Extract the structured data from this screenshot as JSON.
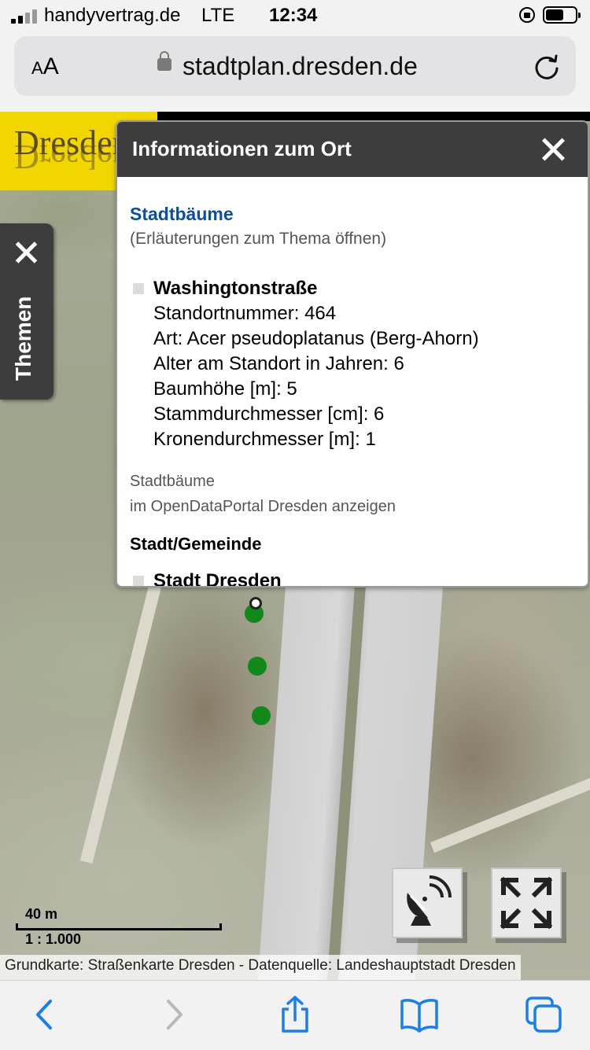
{
  "status_bar": {
    "carrier": "handyvertrag.de",
    "network": "LTE",
    "time": "12:34"
  },
  "browser": {
    "text_size_label_small": "A",
    "text_size_label_large": "A",
    "url": "stadtplan.dresden.de",
    "icons": {
      "lock": "padlock-icon",
      "reload": "reload-icon",
      "back": "chevron-left-icon",
      "forward": "chevron-right-icon",
      "share": "share-icon",
      "bookmarks": "book-icon",
      "tabs": "tabs-icon"
    }
  },
  "map": {
    "logo_text": "Dresden",
    "themen_label": "Themen",
    "scale": {
      "distance": "40 m",
      "ratio": "1 : 1.000"
    },
    "attribution": "Grundkarte: Straßenkarte Dresden - Datenquelle: Landeshauptstadt Dresden",
    "buttons": {
      "locate": "satellite-dish-icon",
      "fullscreen": "expand-arrows-icon"
    }
  },
  "popup": {
    "title": "Informationen zum Ort",
    "theme_link": "Stadtbäume",
    "theme_sub": "(Erläuterungen zum Thema öffnen)",
    "feature": {
      "name": "Washingtonstraße",
      "attributes": [
        "Standortnummer: 464",
        "Art: Acer pseudoplatanus (Berg-Ahorn)",
        "Alter am Standort in Jahren: 6",
        "Baumhöhe [m]: 5",
        "Stammdurchmesser [cm]: 6",
        "Kronendurchmesser [m]: 1"
      ]
    },
    "source_line1": "Stadtbäume",
    "source_line2": "im OpenDataPortal Dresden anzeigen",
    "section2_title": "Stadt/Gemeinde",
    "section2_item": "Stadt Dresden"
  },
  "colors": {
    "popup_header": "#3d3d3d",
    "link_blue": "#0a4fa0",
    "tree_marker": "#11881a",
    "logo_yellow": "#f2d600",
    "ios_blue": "#1a7ef0"
  }
}
